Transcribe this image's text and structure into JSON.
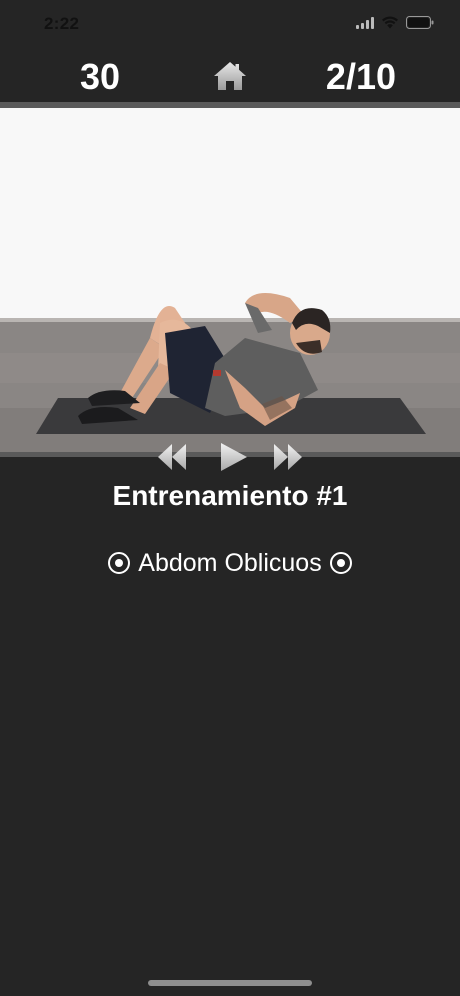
{
  "status_bar": {
    "time": "2:22"
  },
  "header": {
    "timer": "30",
    "counter": "2/10",
    "home_icon": "home-icon"
  },
  "video": {
    "description_icon": "exercise-video"
  },
  "controls": {
    "rewind_icon": "rewind-icon",
    "play_icon": "play-icon",
    "forward_icon": "fast-forward-icon"
  },
  "workout": {
    "title": "Entrenamiento #1",
    "exercise_name": "Abdom Oblicuos"
  },
  "colors": {
    "background": "#252525",
    "divider": "#5a5a5a",
    "text": "#ffffff"
  }
}
